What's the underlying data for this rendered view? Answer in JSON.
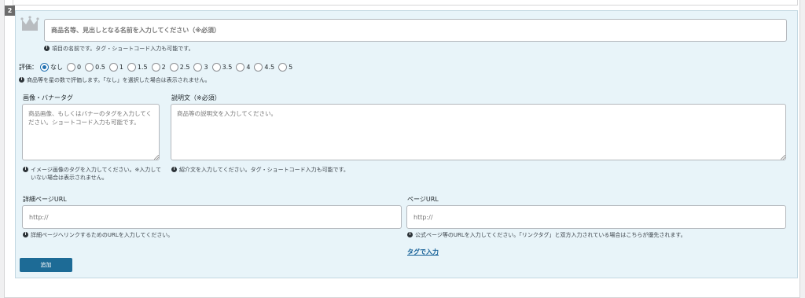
{
  "item_number": "2",
  "title_field": {
    "placeholder": "商品名等、見出しとなる名前を入力してください（※必須）"
  },
  "title_hint": "項目の名前です。タグ・ショートコード入力も可能です。",
  "rating": {
    "label": "評価：",
    "selected": "なし",
    "options": [
      "なし",
      "0",
      "0.5",
      "1",
      "1.5",
      "2",
      "2.5",
      "3",
      "3.5",
      "4",
      "4.5",
      "5"
    ],
    "hint": "商品等を星の数で評価します。「なし」を選択した場合は表示されません。"
  },
  "image_field": {
    "label": "画像・バナータグ",
    "placeholder": "商品画像、もしくはバナーのタグを入力してください。ショートコード入力も可能です。",
    "hint": "イメージ画像のタグを入力してください。※入力していない場合は表示されません。"
  },
  "description_field": {
    "label": "説明文（※必須）",
    "placeholder": "商品等の説明文を入力してください。",
    "hint": "紹介文を入力してください。タグ・ショートコード入力も可能です。"
  },
  "detail_url_field": {
    "label": "詳細ページURL",
    "placeholder": "http://",
    "hint": "詳細ページへリンクするためのURLを入力してください。"
  },
  "page_url_field": {
    "label": "ページURL",
    "placeholder": "http://",
    "hint": "公式ページ等のURLを入力してください。「リンクタグ」と双方入力されている場合はこちらが優先されます。"
  },
  "tag_input_link": "タグで入力",
  "add_button_label": "追加",
  "icons": {
    "crown": "crown-icon",
    "info": "info-icon"
  },
  "colors": {
    "panel_bg": "#e8f4f9",
    "accent": "#2271b1",
    "button": "#1d6b96"
  }
}
